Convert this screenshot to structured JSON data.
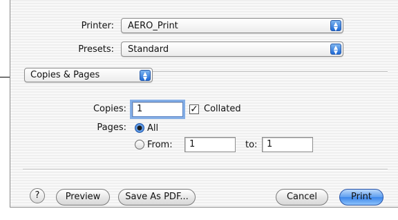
{
  "printer": {
    "label": "Printer:",
    "value": "AERO_Print"
  },
  "presets": {
    "label": "Presets:",
    "value": "Standard"
  },
  "panel_menu": {
    "value": "Copies & Pages"
  },
  "copies": {
    "label": "Copies:",
    "value": "1",
    "collated_label": "Collated",
    "collated_checked": true
  },
  "pages": {
    "label": "Pages:",
    "all_label": "All",
    "from_label": "From:",
    "from_value": "1",
    "to_label": "to:",
    "to_value": "1",
    "selected": "all"
  },
  "buttons": {
    "help": "?",
    "preview": "Preview",
    "save_pdf": "Save As PDF...",
    "cancel": "Cancel",
    "print": "Print"
  },
  "icons": {
    "stepper": "up-down-arrows-icon",
    "check": "checkmark-icon"
  }
}
